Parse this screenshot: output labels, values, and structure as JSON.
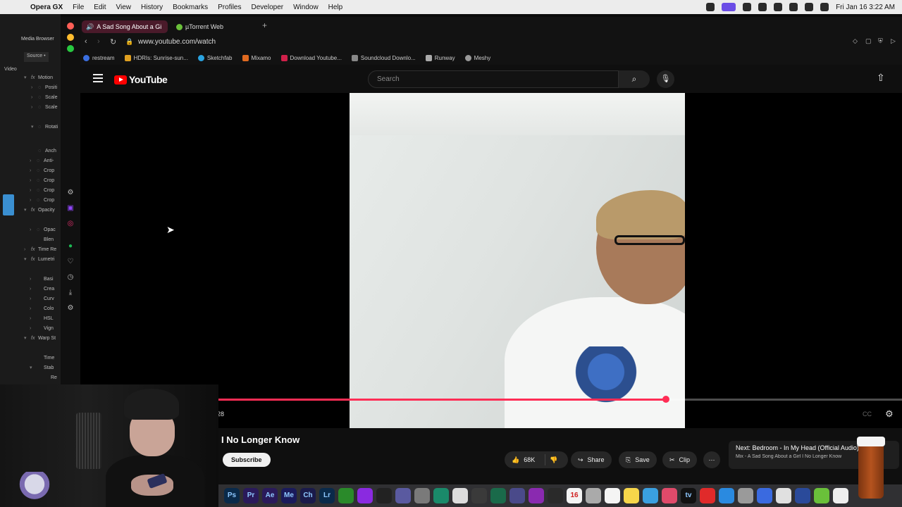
{
  "menubar": {
    "app_name": "Opera GX",
    "items": [
      "File",
      "Edit",
      "View",
      "History",
      "Bookmarks",
      "Profiles",
      "Developer",
      "Window",
      "Help"
    ],
    "datetime": "Fri Jan 16  3:22 AM"
  },
  "editor_panel": {
    "title": "Media Browser",
    "source_tab": "Source •",
    "section": "Video",
    "rows": [
      {
        "label": "Motion",
        "top": 0
      },
      {
        "label": "Positi"
      },
      {
        "label": "Scale"
      },
      {
        "label": "Scale"
      },
      {
        "label": "Rotati"
      },
      {
        "label": "Anch"
      },
      {
        "label": "Anti-"
      },
      {
        "label": "Crop"
      },
      {
        "label": "Crop"
      },
      {
        "label": "Crop"
      },
      {
        "label": "Crop"
      },
      {
        "label": "Opacity"
      },
      {
        "label": "Opac"
      },
      {
        "label": "Blen"
      },
      {
        "label": "Time Re"
      },
      {
        "label": "Lumetri"
      },
      {
        "label": "Basi"
      },
      {
        "label": "Crea"
      },
      {
        "label": "Curv"
      },
      {
        "label": "Colo"
      },
      {
        "label": "HSL"
      },
      {
        "label": "Vign"
      },
      {
        "label": "Warp St"
      },
      {
        "label": "Time"
      },
      {
        "label": "Stab"
      },
      {
        "label": "Re"
      }
    ]
  },
  "browser": {
    "tabs": [
      {
        "label": "A Sad Song About a Gi"
      },
      {
        "label": "µTorrent Web"
      }
    ],
    "new_tab": "+",
    "url": "www.youtube.com/watch",
    "bookmarks": [
      {
        "label": "restream",
        "color": "#3b6fe0"
      },
      {
        "label": "HDRIs: Sunrise-sun...",
        "color": "#e0a020"
      },
      {
        "label": "Sketchfab",
        "color": "#2aa3e0"
      },
      {
        "label": "Mixamo",
        "color": "#e06a20"
      },
      {
        "label": "Download Youtube...",
        "color": "#d0204a"
      },
      {
        "label": "Soundcloud Downlo...",
        "color": "#888888"
      },
      {
        "label": "Runway",
        "color": "#aaaaaa"
      },
      {
        "label": "Meshy",
        "color": "#999999"
      }
    ]
  },
  "youtube": {
    "logo_text": "YouTube",
    "search_placeholder": "Search",
    "video": {
      "timecode": "28",
      "progress": 0.655
    },
    "title": "I No Longer Know",
    "subscribe_label": "Subscribe",
    "likes": "68K",
    "share_label": "Share",
    "save_label": "Save",
    "clip_label": "Clip",
    "next_title": "Next: Bedroom - In My Head (Official Audio)",
    "next_subtitle": "Mix - A Sad Song About a Girl I No Longer Know"
  },
  "dock": {
    "apps": [
      {
        "label": "Ps",
        "color": "#0a2a4a"
      },
      {
        "label": "Pr",
        "color": "#2a1a5a"
      },
      {
        "label": "Ae",
        "color": "#2a1a5a"
      },
      {
        "label": "Me",
        "color": "#1a1a5a"
      },
      {
        "label": "Ch",
        "color": "#1a1a4a"
      },
      {
        "label": "Lr",
        "color": "#0a2a4a"
      },
      {
        "label": "",
        "color": "#2a8a2a"
      },
      {
        "label": "",
        "color": "#8a2ae0"
      },
      {
        "label": "",
        "color": "#222222"
      },
      {
        "label": "",
        "color": "#5a5aa0"
      },
      {
        "label": "",
        "color": "#7a7a7a"
      },
      {
        "label": "",
        "color": "#1a8a6a"
      },
      {
        "label": "",
        "color": "#dddddd"
      },
      {
        "label": "",
        "color": "#3a3a3a"
      },
      {
        "label": "",
        "color": "#1a6a4a"
      },
      {
        "label": "",
        "color": "#4a4a8a"
      },
      {
        "label": "",
        "color": "#8a2ab0"
      },
      {
        "label": "",
        "color": "#2a2a2a"
      },
      {
        "label": "16",
        "color": "#f4f4f4"
      },
      {
        "label": "",
        "color": "#aaaaaa"
      },
      {
        "label": "",
        "color": "#f4f4f4"
      },
      {
        "label": "",
        "color": "#f6d64a"
      },
      {
        "label": "",
        "color": "#3aa0e0"
      },
      {
        "label": "",
        "color": "#e04a6a"
      },
      {
        "label": "tv",
        "color": "#111111"
      },
      {
        "label": "",
        "color": "#e02a2a"
      },
      {
        "label": "",
        "color": "#2a8ae0"
      },
      {
        "label": "",
        "color": "#9a9a9a"
      },
      {
        "label": "",
        "color": "#3a6ae0"
      },
      {
        "label": "",
        "color": "#e0e0e0"
      },
      {
        "label": "",
        "color": "#2a4a9a"
      },
      {
        "label": "",
        "color": "#6ac03a"
      },
      {
        "label": "",
        "color": "#eeeeee"
      }
    ]
  }
}
